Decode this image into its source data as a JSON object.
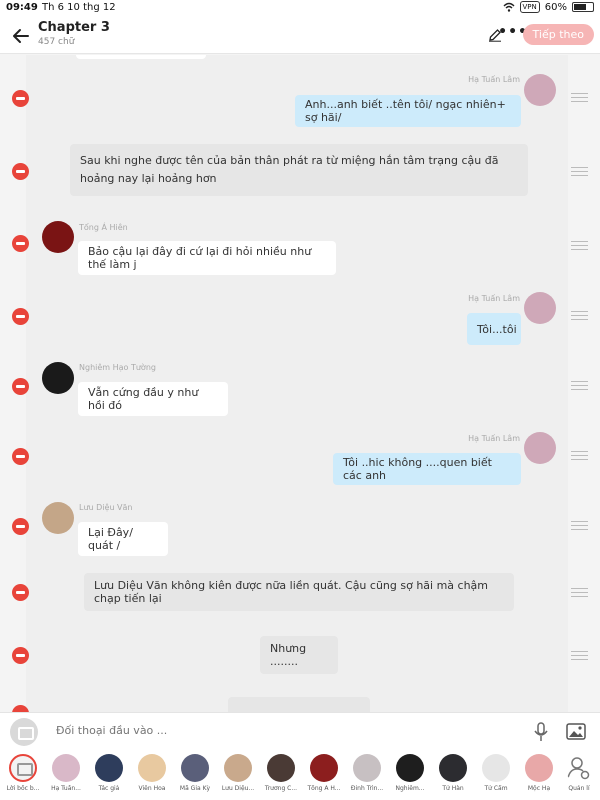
{
  "status_bar": {
    "time": "09:49",
    "date": "Th 6 10 thg 12",
    "vpn": "VPN",
    "battery": "60%"
  },
  "header": {
    "title": "Chapter 3",
    "subtitle": "457 chữ",
    "next_label": "Tiếp theo"
  },
  "messages": [
    {
      "type": "right",
      "name": "Hạ Tuấn Lâm",
      "text": "Anh...anh biết ..tên tôi/ ngạc nhiên+ sợ hãi/"
    },
    {
      "type": "narration",
      "text": "Sau khi nghe được tên của bản thân phát ra từ miệng hắn tâm trạng cậu đã hoảng nay lại hoảng hơn"
    },
    {
      "type": "left",
      "name": "Tống Á Hiên",
      "text": "Bảo cậu lại đây đi cứ lại đi hỏi nhiều như thế làm j"
    },
    {
      "type": "right",
      "name": "Hạ Tuấn Lâm",
      "text": "Tôi...tôi"
    },
    {
      "type": "left",
      "name": "Nghiêm Hạo Tường",
      "text": "Vẫn cứng đầu y như hồi đó"
    },
    {
      "type": "right",
      "name": "Hạ Tuấn Lâm",
      "text": "Tôi ..hic không ....quen biết các anh"
    },
    {
      "type": "left",
      "name": "Lưu Diệu Văn",
      "text": "Lại Đây/ quát /"
    },
    {
      "type": "narration",
      "text": "Lưu Diệu Văn không kiên được nữa liền quát. Cậu cũng sợ hãi mà chậm chạp tiến lại"
    },
    {
      "type": "narration",
      "text": "Nhưng ........"
    }
  ],
  "input": {
    "placeholder": "Đối thoại đầu vào ..."
  },
  "characters": [
    {
      "label": "Lời bốc b...",
      "color": "#f3f3f3"
    },
    {
      "label": "Hạ Tuấn...",
      "color": "#d9b8c8"
    },
    {
      "label": "Tác giả",
      "color": "#2e3d5c"
    },
    {
      "label": "Viên Hoa",
      "color": "#e8c9a0"
    },
    {
      "label": "Mã Gia Kỳ",
      "color": "#5a5f7a"
    },
    {
      "label": "Lưu Diệu...",
      "color": "#c9a98c"
    },
    {
      "label": "Trương C...",
      "color": "#4a3a35"
    },
    {
      "label": "Tống Á H...",
      "color": "#8c1e1e"
    },
    {
      "label": "Đinh Trìn...",
      "color": "#c7c0c2"
    },
    {
      "label": "Nghiêm...",
      "color": "#1e1e1e"
    },
    {
      "label": "Tử Hàn",
      "color": "#2c2c30"
    },
    {
      "label": "Tử Cẩm",
      "color": "#e6e6e6"
    },
    {
      "label": "Mộc Hạ",
      "color": "#e8a8a8"
    },
    {
      "label": "Quản lí",
      "color": "#ffffff"
    }
  ],
  "avatar_colors": {
    "ha_tuan_lam": "#cfa8b8",
    "tong_a_hien": "#7a1414",
    "nghiem_hao_tuong": "#1a1a1a",
    "luu_dieu_van": "#c4a688"
  },
  "icons": {
    "back": "arrow-left-icon",
    "edit": "pencil-icon",
    "more": "more-dots-icon",
    "delete": "minus-circle-icon",
    "reorder": "drag-handle-icon",
    "mic": "microphone-icon",
    "image": "image-icon",
    "manage": "person-gear-icon"
  }
}
